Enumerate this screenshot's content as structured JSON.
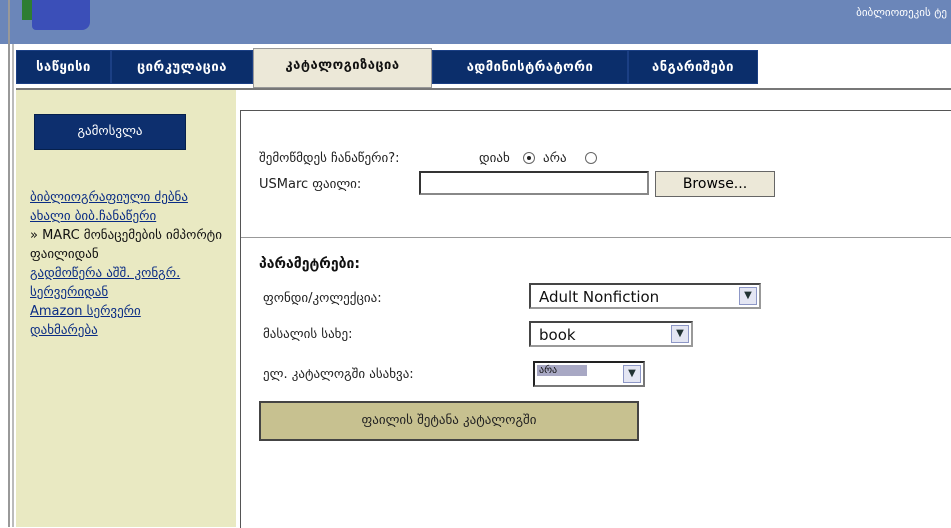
{
  "header": {
    "right_text": "ბიბლიოთეკის ტე"
  },
  "tabs": [
    {
      "label": "საწყისი"
    },
    {
      "label": "ცირკულაცია"
    },
    {
      "label": "კატალოგიზაცია",
      "active": true
    },
    {
      "label": "ადმინისტრატორი"
    },
    {
      "label": "ანგარიშები"
    }
  ],
  "sidebar": {
    "logout_label": "გამოსვლა",
    "links": [
      "ბიბლიოგრაფიული ძებნა",
      "ახალი ბიბ.ჩანაწერი",
      "» MARC მონაცემების იმპორტი ფაილიდან",
      "გადმოწერა აშშ. კონგრ. სერვერიდან",
      "Amazon სერვერი",
      "დახმარება"
    ]
  },
  "form": {
    "test_load_label": "შემოწმდეს ჩანაწერი?:",
    "yes_label": "დიახ",
    "no_label": "არა",
    "yes_checked": true,
    "usmarc_label": "USMarc ფაილი:",
    "browse_label": "Browse...",
    "params_title": "პარამეტრები:",
    "collection_label": "ფონდი/კოლექცია:",
    "collection_value": "Adult Nonfiction",
    "material_label": "მასალის სახე:",
    "material_value": "book",
    "opac_label": "ელ. კატალოგში ასახვა:",
    "opac_value": "არა",
    "submit_label": "ფაილის შეტანა კატალოგში"
  },
  "colors": {
    "tab_bg": "#0b2e6b",
    "sidebar_bg": "#e9e9c2",
    "header_bg": "#6b86b9",
    "submit_bg": "#c7c190"
  }
}
